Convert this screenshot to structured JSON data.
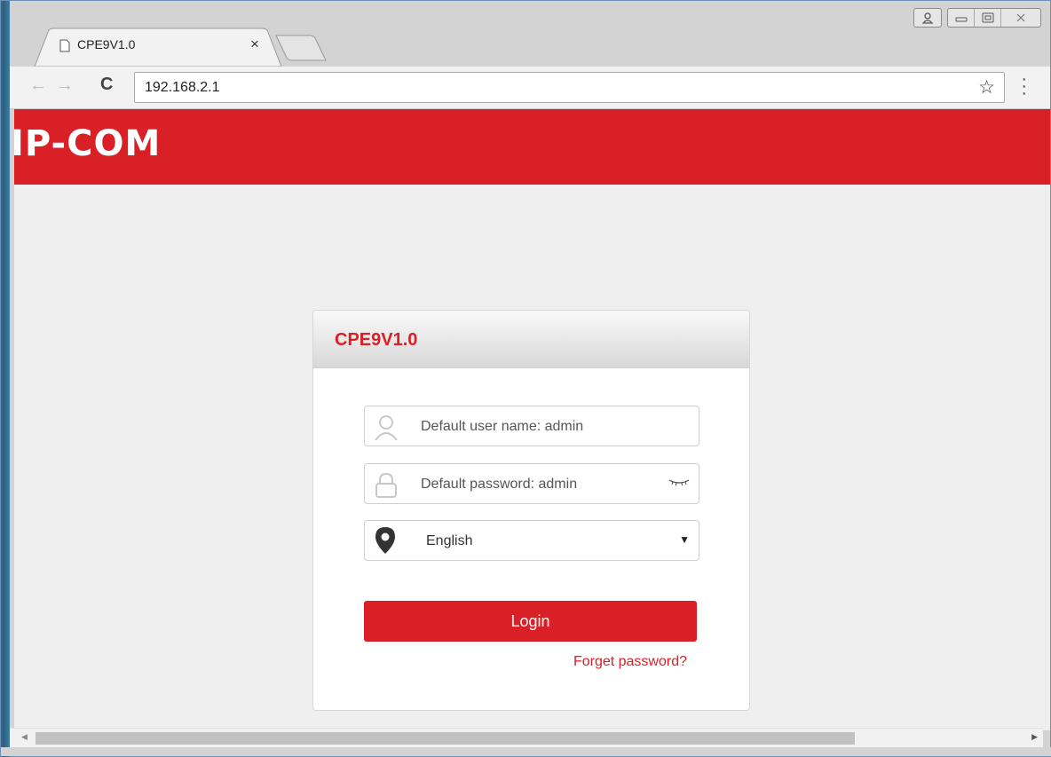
{
  "browser": {
    "tab_title": "CPE9V1.0",
    "tab_close": "×",
    "url": "192.168.2.1",
    "nav": {
      "back": "←",
      "forward": "→",
      "reload": "C"
    },
    "bookmark_icon": "star-icon",
    "menu_icon": "kebab-menu-icon"
  },
  "page": {
    "brand": "IP-COM",
    "brand_color": "#d92027",
    "card_title": "CPE9V1.0",
    "username_placeholder": "Default user name: admin",
    "password_placeholder": "Default password: admin",
    "language": "English",
    "login_label": "Login",
    "forgot_label": "Forget password?"
  }
}
